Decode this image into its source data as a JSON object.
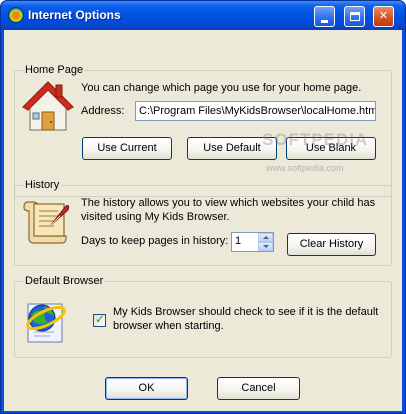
{
  "window": {
    "title": "Internet Options",
    "title_icon": "globe-icon",
    "controls": {
      "minimize": "minimize-icon",
      "maximize": "maximize-icon",
      "close": "✕"
    }
  },
  "home_page": {
    "legend": "Home Page",
    "icon": "house-icon",
    "description": "You can change which page you use for your home page.",
    "address_label": "Address:",
    "address_value": "C:\\Program Files\\MyKidsBrowser\\localHome.html",
    "buttons": {
      "use_current": "Use Current",
      "use_default": "Use Default",
      "use_blank": "Use Blank"
    }
  },
  "history": {
    "legend": "History",
    "icon": "scroll-quill-icon",
    "description_line1": "The history allows you to view which websites your child has",
    "description_line2": "visited using My Kids Browser.",
    "days_label": "Days to keep pages in history:",
    "days_value": "1",
    "clear_button": "Clear History"
  },
  "default_browser": {
    "legend": "Default Browser",
    "icon": "browser-globe-icon",
    "check_line1": "My Kids Browser should check to see if it is the default",
    "check_line2": "browser when starting.",
    "checked": true
  },
  "footer": {
    "ok": "OK",
    "cancel": "Cancel"
  },
  "watermark": {
    "main": "SOFTPEDIA",
    "sub": "www.softpedia.com"
  }
}
